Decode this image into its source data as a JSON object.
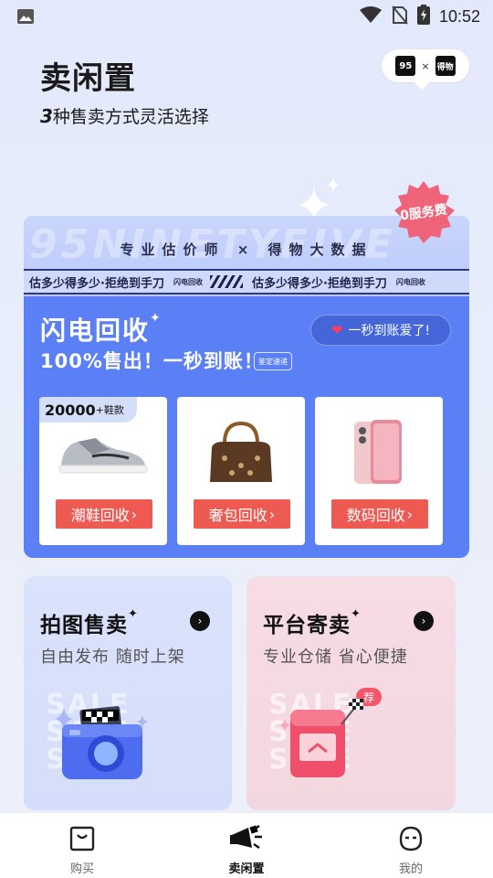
{
  "status_bar": {
    "time": "10:52"
  },
  "header": {
    "title": "卖闲置",
    "subtitle_num": "3",
    "subtitle_text": "种售卖方式灵活选择",
    "collab_logo_left": "95",
    "collab_x": "×",
    "collab_logo_right": "得物"
  },
  "flash": {
    "bg_word": "95NINETYFIVE",
    "pro_line": "专业估价师 × 得物大数据",
    "ticker_text": "估多少得多少·拒绝到手刀",
    "ticker_tiny": "闪电回收",
    "title": "闪电回收",
    "subtitle": "100%售出！一秒到账！",
    "subtitle_tag": "鉴定速递",
    "pill_text": "一秒到账爱了!",
    "free_badge": "0服务费",
    "products": [
      {
        "tag_num": "20000",
        "tag_suffix": "+鞋款",
        "button": "潮鞋回收"
      },
      {
        "button": "奢包回收"
      },
      {
        "button": "数码回收"
      }
    ]
  },
  "modes": [
    {
      "title": "拍图售卖",
      "desc": "自由发布 随时上架",
      "ghost": "SALE\nSALE\nSALE"
    },
    {
      "title": "平台寄卖",
      "desc": "专业仓储 省心便捷",
      "ghost": "SALE\nSALE\nSALE",
      "badge": "荐"
    }
  ],
  "tabs": [
    {
      "label": "购买"
    },
    {
      "label": "卖闲置"
    },
    {
      "label": "我的"
    }
  ],
  "colors": {
    "accent_blue": "#5b80f6",
    "button_red": "#ec5a52",
    "badge_pink": "#f3566a"
  }
}
